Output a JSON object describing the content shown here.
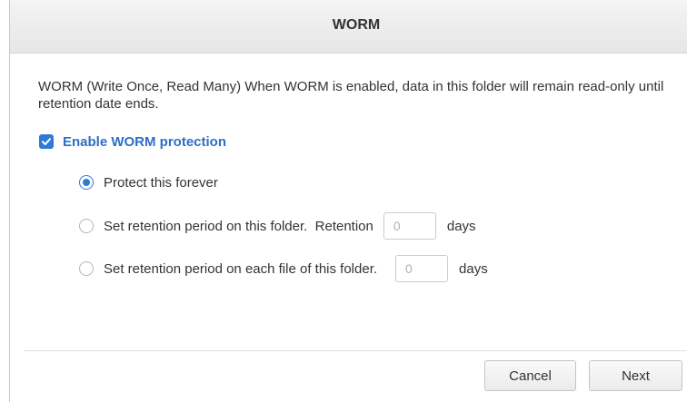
{
  "dialog": {
    "title": "WORM",
    "description": "WORM (Write Once, Read Many) When WORM is enabled, data in this folder will remain read-only until retention date ends.",
    "enable_checkbox": {
      "label": "Enable WORM protection",
      "checked": true
    },
    "options": [
      {
        "label": "Protect this forever",
        "selected": true
      },
      {
        "label": "Set retention period on this folder.  Retention",
        "selected": false,
        "input_value": "0",
        "unit": "days"
      },
      {
        "label": "Set retention period on each file of this folder.",
        "selected": false,
        "input_value": "0",
        "unit": "days"
      }
    ],
    "buttons": {
      "cancel": "Cancel",
      "next": "Next"
    }
  },
  "colors": {
    "accent": "#2f7ad6",
    "accent_text": "#2d6fc4",
    "title_bar": "#ececec",
    "text": "#333333"
  },
  "icons": {
    "checkbox": "checkmark-icon",
    "radio_selected": "radio-selected-icon",
    "radio_unselected": "radio-unselected-icon"
  }
}
